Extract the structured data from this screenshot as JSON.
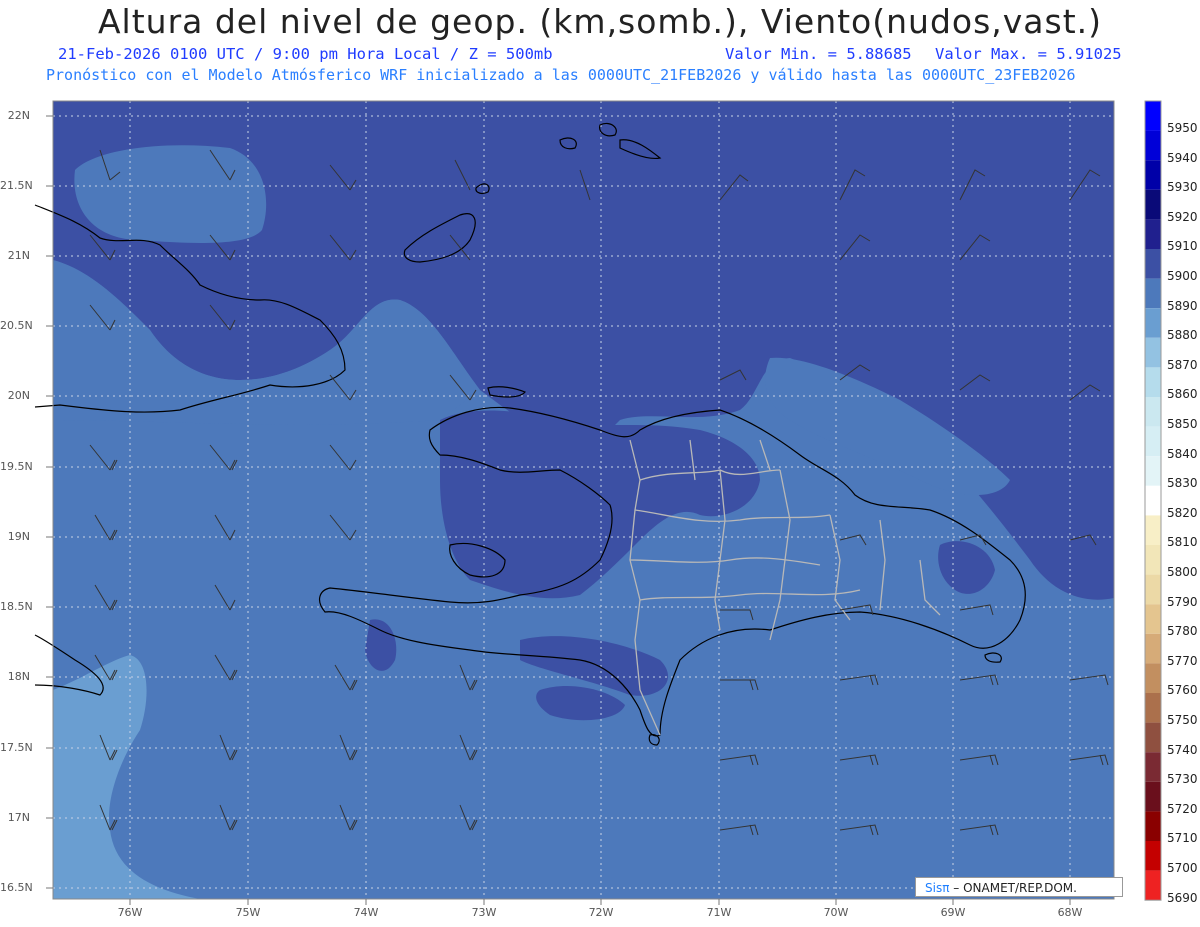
{
  "header": {
    "title": "Altura del nivel de geop. (km,somb.), Viento(nudos,vast.)",
    "date_line": "21-Feb-2026  0100 UTC / 9:00 pm Hora Local / Z = 500mb",
    "min_label": "Valor Min. = 5.88685",
    "max_label": "Valor Max. = 5.91025",
    "model_line": "Pronóstico con el Modelo Atmósferico WRF inicializado a las 0000UTC_21FEB2026 y válido hasta las  0000UTC_23FEB2026"
  },
  "axes": {
    "lat_labels": [
      "22N",
      "21.5N",
      "21N",
      "20.5N",
      "20N",
      "19.5N",
      "19N",
      "18.5N",
      "18N",
      "17.5N",
      "17N",
      "16.5N"
    ],
    "lon_labels": [
      "76W",
      "75W",
      "74W",
      "73W",
      "72W",
      "71W",
      "70W",
      "69W",
      "68W"
    ]
  },
  "colorbar": {
    "levels": [
      "5950",
      "5940",
      "5930",
      "5920",
      "5910",
      "5900",
      "5890",
      "5880",
      "5870",
      "5860",
      "5850",
      "5840",
      "5830",
      "5820",
      "5810",
      "5800",
      "5790",
      "5780",
      "5770",
      "5760",
      "5750",
      "5740",
      "5730",
      "5720",
      "5710",
      "5700",
      "5690"
    ],
    "colors": [
      "#0000ff",
      "#0000d8",
      "#0000a8",
      "#0a0a78",
      "#20208e",
      "#3c50a4",
      "#4d79bb",
      "#6a9ed1",
      "#93c2e2",
      "#b5dcec",
      "#cbe8f0",
      "#d6eef4",
      "#e3f4f7",
      "#ffffff",
      "#f8efc7",
      "#f2e6b8",
      "#ecd9a6",
      "#e4c58f",
      "#d6ab78",
      "#c28f60",
      "#ab704c",
      "#8f5040",
      "#7a2a33",
      "#6a0f1c",
      "#8a0000",
      "#c40000",
      "#ee2222"
    ]
  },
  "map_colors": {
    "dark": "#3c50a4",
    "mid": "#4d79bb",
    "light": "#6a9ed1"
  },
  "credit": {
    "sis": "Sis",
    "pi": "π",
    "rest": "– ONAMET/REP.DOM."
  }
}
